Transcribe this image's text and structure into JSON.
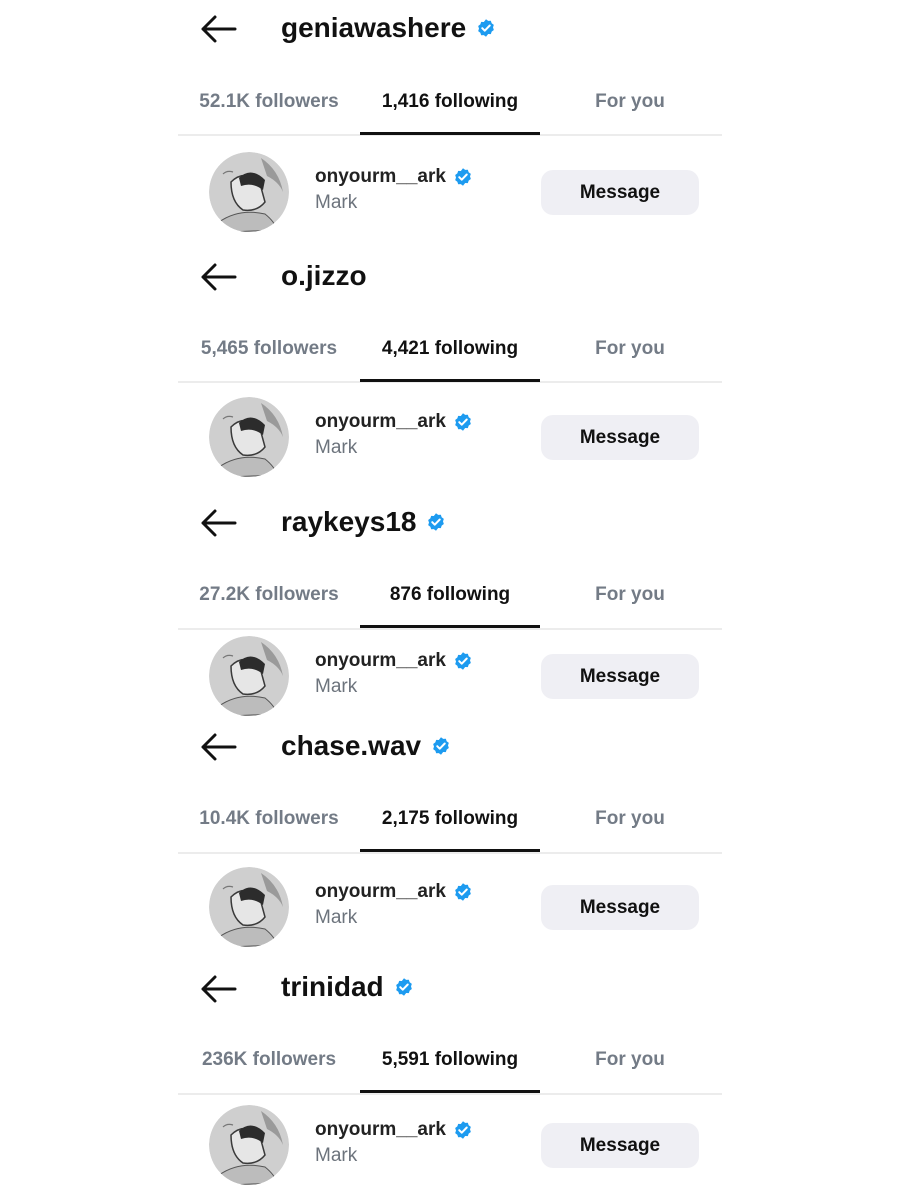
{
  "colors": {
    "verified_badge": "#1d9bf0",
    "tab_active": "#111111",
    "tab_inactive": "#737b86",
    "button_bg": "#efeff4"
  },
  "icons": {
    "back": "back-arrow-icon",
    "verified": "verified-badge-icon",
    "avatar": "pencil-sketch-avatar"
  },
  "panels": [
    {
      "title": "geniawashere",
      "verified": true,
      "tabs": {
        "followers": "52.1K followers",
        "following": "1,416 following",
        "for_you": "For you"
      },
      "user": {
        "username": "onyourm__ark",
        "full_name": "Mark",
        "button": "Message"
      }
    },
    {
      "title": "o.jizzo",
      "verified": false,
      "tabs": {
        "followers": "5,465 followers",
        "following": "4,421 following",
        "for_you": "For you"
      },
      "user": {
        "username": "onyourm__ark",
        "full_name": "Mark",
        "button": "Message"
      }
    },
    {
      "title": "raykeys18",
      "verified": true,
      "tabs": {
        "followers": "27.2K followers",
        "following": "876 following",
        "for_you": "For you"
      },
      "user": {
        "username": "onyourm__ark",
        "full_name": "Mark",
        "button": "Message"
      }
    },
    {
      "title": "chase.wav",
      "verified": true,
      "tabs": {
        "followers": "10.4K followers",
        "following": "2,175 following",
        "for_you": "For you"
      },
      "user": {
        "username": "onyourm__ark",
        "full_name": "Mark",
        "button": "Message"
      }
    },
    {
      "title": "trinidad",
      "verified": true,
      "tabs": {
        "followers": "236K followers",
        "following": "5,591 following",
        "for_you": "For you"
      },
      "user": {
        "username": "onyourm__ark",
        "full_name": "Mark",
        "button": "Message"
      }
    }
  ]
}
